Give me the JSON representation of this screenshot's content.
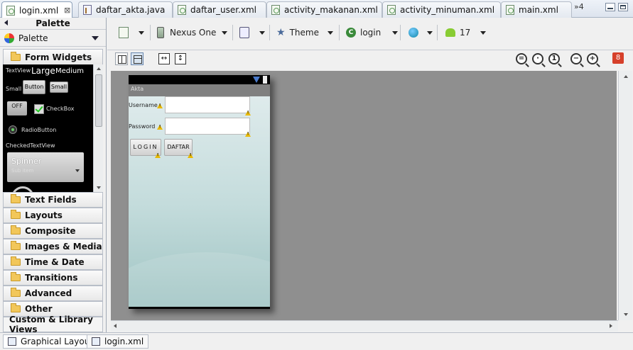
{
  "tabs": [
    {
      "label": "login.xml",
      "active": true,
      "kind": "xml"
    },
    {
      "label": "daftar_akta.java",
      "active": false,
      "kind": "java"
    },
    {
      "label": "daftar_user.xml",
      "active": false,
      "kind": "xml"
    },
    {
      "label": "activity_makanan.xml",
      "active": false,
      "kind": "xml"
    },
    {
      "label": "activity_minuman.xml",
      "active": false,
      "kind": "xml"
    },
    {
      "label": "main.xml",
      "active": false,
      "kind": "xml"
    }
  ],
  "tab_close_symbol": "⊠",
  "tabs_more": "»4",
  "palette": {
    "header": "Palette",
    "title": "Palette",
    "open_category": "Form Widgets",
    "categories": [
      "Text Fields",
      "Layouts",
      "Composite",
      "Images & Media",
      "Time & Date",
      "Transitions",
      "Advanced",
      "Other"
    ],
    "custom": "Custom & Library Views",
    "preview": {
      "textview": "TextView",
      "large": "Large",
      "medium": "Medium",
      "small": "Small",
      "button": "Button",
      "small_button": "Small",
      "toggle": "OFF",
      "checkbox": "CheckBox",
      "radio": "RadioButton",
      "checked_text": "CheckedTextView",
      "spinner": "Spinner",
      "spinner_sub": "Sub item"
    }
  },
  "toolbar": {
    "device": "Nexus One",
    "theme": "Theme",
    "activity": "login",
    "api_level": "17",
    "lint_count": "8"
  },
  "device_screen": {
    "title": "Akta",
    "username_label": "Username",
    "password_label": "Password",
    "login_button": "LOGIN",
    "daftar_button": "DAFTAR"
  },
  "bottom_tabs": [
    {
      "label": "Graphical Layout",
      "active": true
    },
    {
      "label": "login.xml",
      "active": false
    }
  ]
}
